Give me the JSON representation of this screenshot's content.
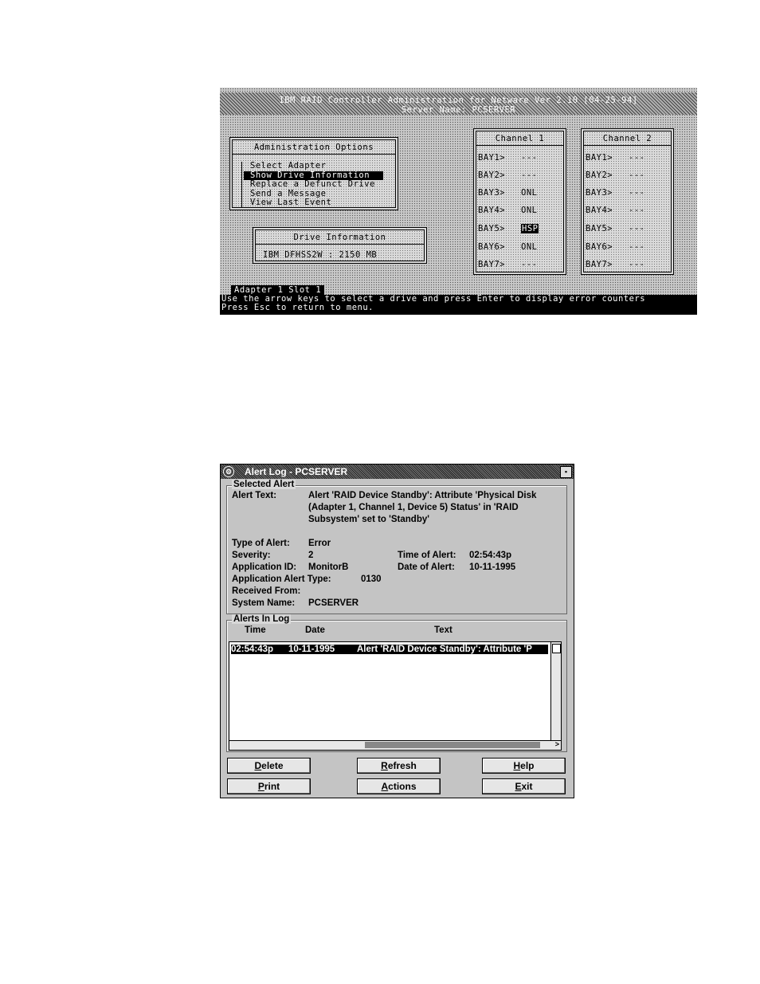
{
  "raid_admin": {
    "title": "IBM RAID Controller Administration for Netware  Ver 2.10 [04-25-94]",
    "server": "Server Name: PCSERVER",
    "options_header": "Administration Options",
    "options": [
      {
        "label": "Select Adapter",
        "selected": false
      },
      {
        "label": "Show Drive Information",
        "selected": true
      },
      {
        "label": "Replace a Defunct Drive",
        "selected": false
      },
      {
        "label": "Send a Message",
        "selected": false
      },
      {
        "label": "View Last Event",
        "selected": false
      }
    ],
    "drive_info_header": "Drive Information",
    "drive_info_text": "IBM     DFHSS2W  : 2150 MB",
    "channels": [
      {
        "name": "Channel 1",
        "bays": [
          {
            "bay": "BAY1>",
            "status": "---"
          },
          {
            "bay": "BAY2>",
            "status": "---"
          },
          {
            "bay": "BAY3>",
            "status": "ONL"
          },
          {
            "bay": "BAY4>",
            "status": "ONL"
          },
          {
            "bay": "BAY5>",
            "status": "HSP",
            "highlight": true
          },
          {
            "bay": "BAY6>",
            "status": "ONL"
          },
          {
            "bay": "BAY7>",
            "status": "---"
          }
        ]
      },
      {
        "name": "Channel 2",
        "bays": [
          {
            "bay": "BAY1>",
            "status": "---"
          },
          {
            "bay": "BAY2>",
            "status": "---"
          },
          {
            "bay": "BAY3>",
            "status": "---"
          },
          {
            "bay": "BAY4>",
            "status": "---"
          },
          {
            "bay": "BAY5>",
            "status": "---"
          },
          {
            "bay": "BAY6>",
            "status": "---"
          },
          {
            "bay": "BAY7>",
            "status": "---"
          }
        ]
      }
    ],
    "status_slot": "Adapter 1 Slot 1",
    "status_line1": "Use the arrow keys to select a drive and press Enter to display error counters",
    "status_line2": "Press Esc to return to menu."
  },
  "alert_log": {
    "title": "Alert Log - PCSERVER",
    "selected_alert_label": "Selected Alert",
    "alert_text_label": "Alert Text:",
    "alert_text_lines": [
      "Alert 'RAID Device Standby': Attribute 'Physical Disk",
      "(Adapter 1, Channel 1, Device 5) Status' in 'RAID",
      "Subsystem' set to 'Standby'"
    ],
    "type_label": "Type of Alert:",
    "type_value": "Error",
    "severity_label": "Severity:",
    "severity_value": "2",
    "time_label": "Time of Alert:",
    "time_value": "02:54:43p",
    "app_id_label": "Application ID:",
    "app_id_value": "MonitorB",
    "date_label": "Date of Alert:",
    "date_value": "10-11-1995",
    "app_alert_type_label": "Application Alert Type:",
    "app_alert_type_value": "0130",
    "received_from_label": "Received From:",
    "received_from_value": "",
    "system_name_label": "System Name:",
    "system_name_value": "PCSERVER",
    "alerts_in_log_label": "Alerts In Log",
    "columns": [
      "Time",
      "Date",
      "Text"
    ],
    "rows": [
      {
        "time": "02:54:43p",
        "date": "10-11-1995",
        "text": "Alert 'RAID Device Standby': Attribute 'P"
      }
    ],
    "buttons": {
      "delete": "Delete",
      "refresh": "Refresh",
      "help": "Help",
      "print": "Print",
      "actions": "Actions",
      "exit": "Exit"
    }
  }
}
